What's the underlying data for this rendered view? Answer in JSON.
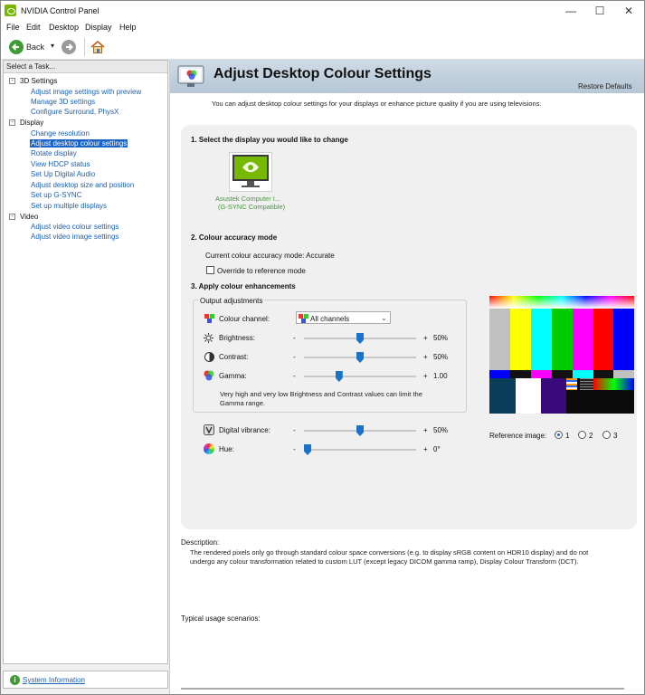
{
  "window": {
    "title": "NVIDIA Control Panel"
  },
  "menu": [
    "File",
    "Edit",
    "Desktop",
    "Display",
    "Help"
  ],
  "toolbar": {
    "back": "Back"
  },
  "sidebar": {
    "header": "Select a Task...",
    "categories": [
      {
        "label": "3D Settings",
        "items": [
          "Adjust image settings with preview",
          "Manage 3D settings",
          "Configure Surround, PhysX"
        ]
      },
      {
        "label": "Display",
        "items": [
          "Change resolution",
          "Adjust desktop colour settings",
          "Rotate display",
          "View HDCP status",
          "Set Up Digital Audio",
          "Adjust desktop size and position",
          "Set up G-SYNC",
          "Set up multiple displays"
        ]
      },
      {
        "label": "Video",
        "items": [
          "Adjust video colour settings",
          "Adjust video image settings"
        ]
      }
    ],
    "selected": "Adjust desktop colour settings",
    "system_info": "System Information"
  },
  "page": {
    "title": "Adjust Desktop Colour Settings",
    "restore": "Restore Defaults",
    "intro": "You can adjust desktop colour settings for your displays or enhance picture quality if you are using televisions.",
    "s1": "1. Select the display you would like to change",
    "display_name": "Asustek Computer I...",
    "display_sub": "(G-SYNC Compatible)",
    "s2": "2. Colour accuracy mode",
    "accuracy": "Current colour accuracy mode: Accurate",
    "override": "Override to reference mode",
    "s3": "3. Apply colour enhancements",
    "output_adj": "Output adjustments",
    "channel_label": "Colour channel:",
    "channel_value": "All channels",
    "brightness": {
      "label": "Brightness:",
      "value": "50%",
      "level": 0.5
    },
    "contrast": {
      "label": "Contrast:",
      "value": "50%",
      "level": 0.5
    },
    "gamma": {
      "label": "Gamma:",
      "value": "1.00",
      "level": 0.3
    },
    "note": "Very high and very low Brightness and Contrast values can limit the Gamma range.",
    "vibrance": {
      "label": "Digital vibrance:",
      "value": "50%",
      "level": 0.5
    },
    "hue": {
      "label": "Hue:",
      "value": "0°",
      "level": 0.0
    },
    "minus": "-",
    "plus": "+",
    "ref_label": "Reference image:",
    "ref_options": [
      "1",
      "2",
      "3"
    ],
    "ref_selected": "1",
    "desc_label": "Description:",
    "desc_text": "The rendered pixels only go through standard colour space conversions (e.g. to display sRGB content on HDR10 display) and do not undergo any colour transformation related to custom LUT (except legacy DICOM gamma ramp), Display Colour Transform (DCT).",
    "usage_label": "Typical usage scenarios:"
  },
  "colors": {
    "accent": "#76b900",
    "link": "#1a5fb4",
    "select": "#1a64c8"
  }
}
